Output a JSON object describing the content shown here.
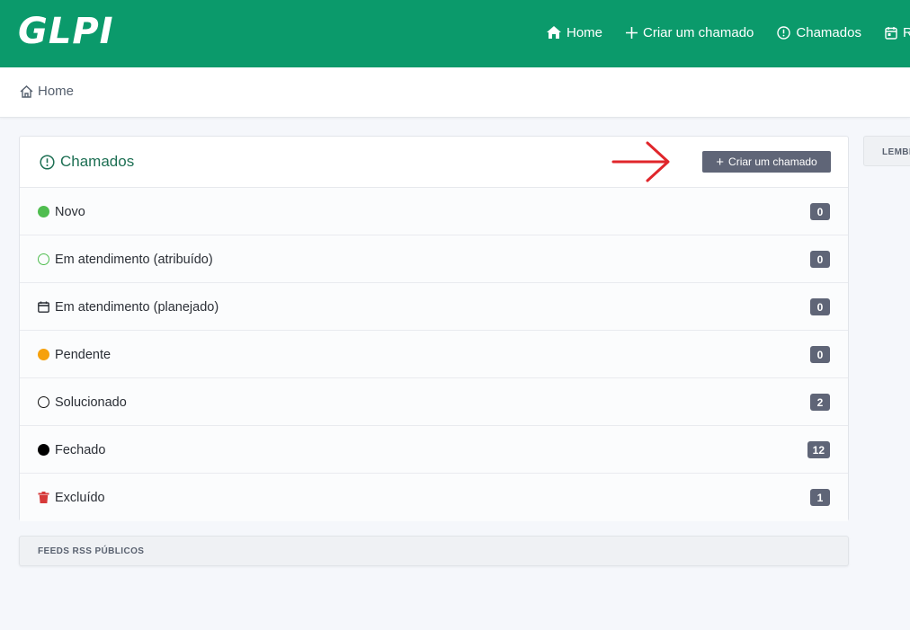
{
  "app": {
    "logo_text": "GLPI"
  },
  "nav": {
    "items": [
      {
        "label": "Home",
        "icon": "home-icon"
      },
      {
        "label": "Criar um chamado",
        "icon": "plus-icon"
      },
      {
        "label": "Chamados",
        "icon": "alert-circle-icon"
      },
      {
        "label": "Re",
        "icon": "calendar-icon"
      }
    ]
  },
  "breadcrumb": {
    "label": "Home",
    "icon": "home-outline-icon"
  },
  "tickets_card": {
    "title": "Chamados",
    "create_button": "Criar um chamado",
    "rows": [
      {
        "label": "Novo",
        "count": "0",
        "icon": "status-new-icon",
        "color": "#4fbd4f"
      },
      {
        "label": "Em atendimento (atribuído)",
        "count": "0",
        "icon": "status-assigned-icon",
        "color": "#4fbd4f"
      },
      {
        "label": "Em atendimento (planejado)",
        "count": "0",
        "icon": "calendar-icon",
        "color": "#2b2f36"
      },
      {
        "label": "Pendente",
        "count": "0",
        "icon": "status-pending-icon",
        "color": "#f6a10c"
      },
      {
        "label": "Solucionado",
        "count": "2",
        "icon": "status-solved-icon",
        "color": "#111111"
      },
      {
        "label": "Fechado",
        "count": "12",
        "icon": "status-closed-icon",
        "color": "#000000"
      },
      {
        "label": "Excluído",
        "count": "1",
        "icon": "trash-icon",
        "color": "#d63939"
      }
    ]
  },
  "feeds": {
    "label": "FEEDS RSS PÚBLICOS"
  },
  "side_panel": {
    "label": "LEMBRETES"
  },
  "colors": {
    "navbar": "#0b9a6b",
    "accent_text": "#1d6f53",
    "badge": "#5f6577",
    "annotation_arrow": "#e0262b"
  }
}
